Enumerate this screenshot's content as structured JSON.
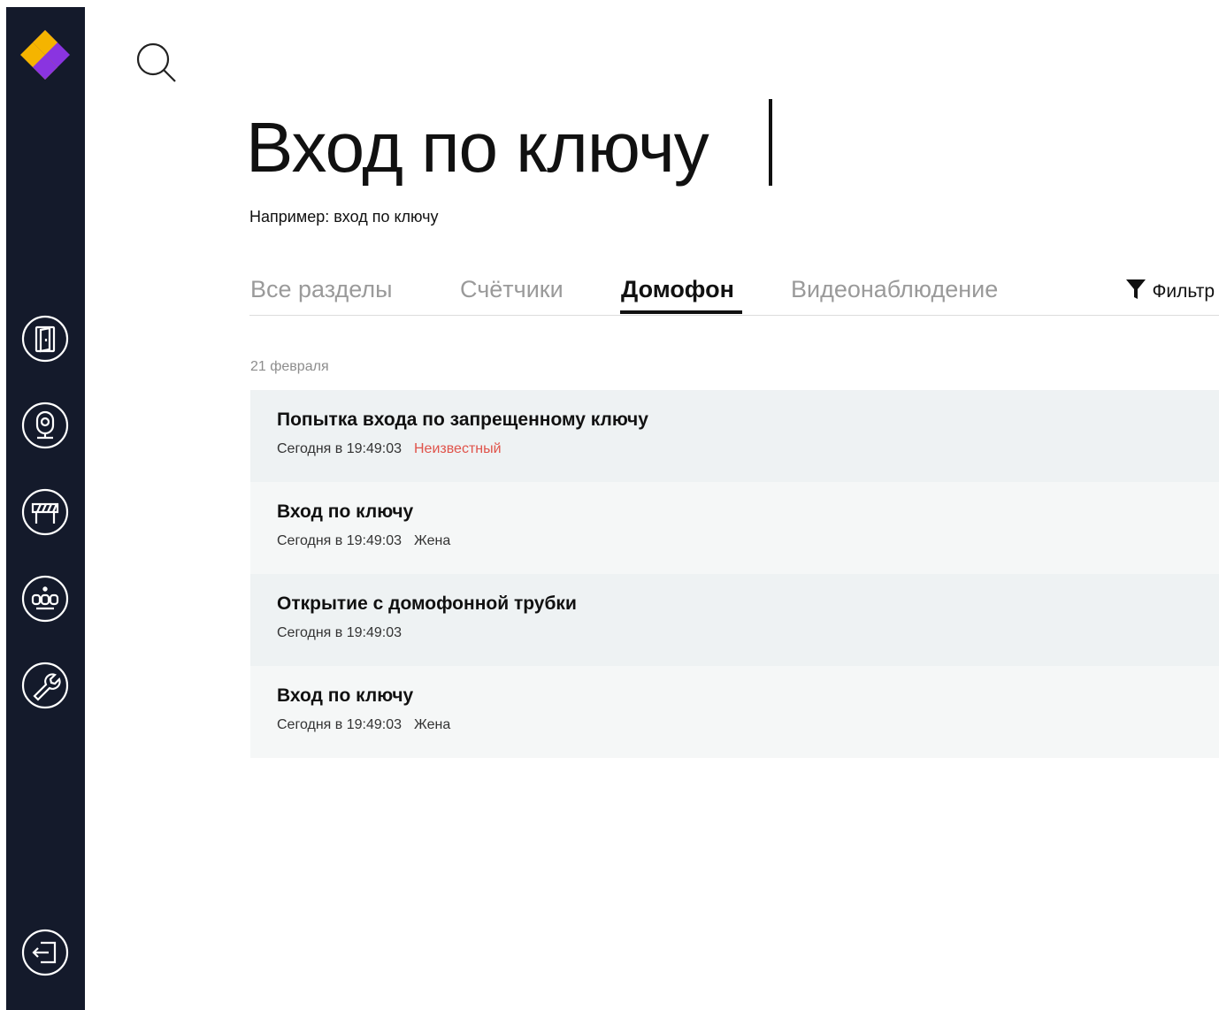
{
  "app": {
    "colors": {
      "sidebar_bg": "#141a2b",
      "logo_yellow": "#f5b400",
      "logo_purple": "#8a34e0",
      "active_text": "#111111",
      "inactive_tab": "#9a9a9a",
      "unknown_red": "#e0534a"
    }
  },
  "sidebar": {
    "logo": "brand-logo-diamond",
    "items": [
      {
        "icon": "door-icon"
      },
      {
        "icon": "camera-icon"
      },
      {
        "icon": "barrier-icon"
      },
      {
        "icon": "intercom-icon"
      },
      {
        "icon": "wrench-icon"
      }
    ],
    "logout_icon": "logout-icon"
  },
  "search": {
    "icon": "search-icon",
    "value": "Вход по ключу",
    "hint": "Например: вход по ключу"
  },
  "tabs": [
    {
      "label": "Все разделы",
      "active": false
    },
    {
      "label": "Счётчики",
      "active": false
    },
    {
      "label": "Домофон",
      "active": true
    },
    {
      "label": "Видеонаблюдение",
      "active": false
    }
  ],
  "filter": {
    "label": "Фильтр",
    "icon": "funnel-icon"
  },
  "date_group": "21 февраля",
  "events": [
    {
      "title": "Попытка входа по запрещенному ключу",
      "time": "Сегодня в 19:49:03",
      "person": "Неизвестный",
      "person_unknown": true
    },
    {
      "title": "Вход по ключу",
      "time": "Сегодня в 19:49:03",
      "person": "Жена",
      "person_unknown": false
    },
    {
      "title": "Открытие с домофонной трубки",
      "time": "Сегодня в 19:49:03",
      "person": "",
      "person_unknown": false
    },
    {
      "title": "Вход по ключу",
      "time": "Сегодня в 19:49:03",
      "person": "Жена",
      "person_unknown": false
    }
  ]
}
